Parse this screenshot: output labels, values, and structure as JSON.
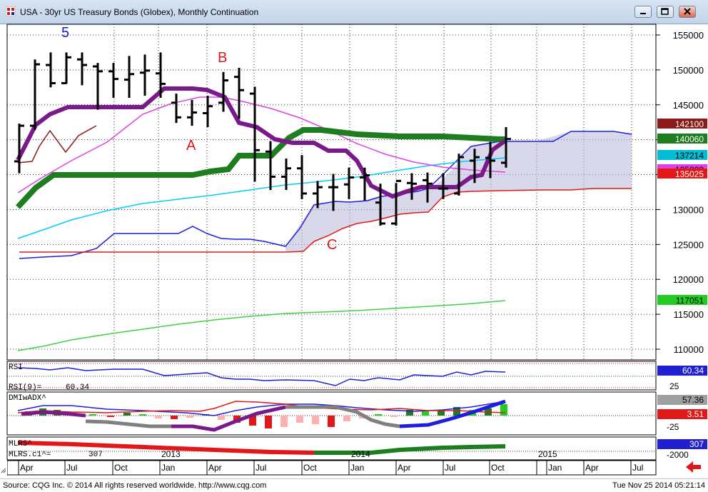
{
  "window": {
    "title": "USA - 30yr US Treasury Bonds (Globex), Monthly Continuation",
    "controls": [
      "minimize",
      "restore",
      "close"
    ]
  },
  "price_axis": {
    "ticks": [
      "155000",
      "150000",
      "145000",
      "140000",
      "135000",
      "130000",
      "125000",
      "120000",
      "115000",
      "110000"
    ]
  },
  "price_labels": [
    {
      "text": "142100",
      "bg": "#8b1a1a",
      "fg": "#ffffff"
    },
    {
      "text": "140060",
      "bg": "#1e7d1e",
      "fg": "#ffffff"
    },
    {
      "text": "137214",
      "bg": "#00bcd4",
      "fg": "#000000"
    },
    {
      "text": "135829",
      "bg": "#e040e0",
      "fg": "#000000"
    },
    {
      "text": "135025",
      "bg": "#e01818",
      "fg": "#ffffff"
    },
    {
      "text": "117051",
      "bg": "#22cc22",
      "fg": "#000000"
    }
  ],
  "annotations": [
    {
      "text": "5",
      "color": "#1a1ad0"
    },
    {
      "text": "B",
      "color": "#e01818"
    },
    {
      "text": "A",
      "color": "#e01818"
    },
    {
      "text": "C",
      "color": "#e01818"
    }
  ],
  "rsi": {
    "header": "RSI",
    "legend": "RSI(9)=",
    "value": "60.34",
    "axis_ticks": [
      "25"
    ]
  },
  "dmi": {
    "header": "DMIwADX^",
    "value_top": "57.36",
    "value_mid": "3.51",
    "axis_ticks": [
      "-25"
    ]
  },
  "mlrs": {
    "header": "MLRS^",
    "legend": "MLRS.c1^=",
    "legend_value": "307",
    "value": "307",
    "axis_ticks": [
      "-2000"
    ],
    "year_labels": [
      "2013",
      "2014"
    ]
  },
  "time_axis": {
    "labels": [
      "Apr",
      "Jul",
      "Oct",
      "Jan",
      "Apr",
      "Jul",
      "Oct",
      "Jan",
      "Apr",
      "Jul",
      "Oct",
      "2015",
      "Jan",
      "Apr",
      "Jul"
    ],
    "divider_years": [
      "2013",
      "2014",
      "2015"
    ]
  },
  "footer": {
    "source": "Source: CQG Inc. © 2014 All rights reserved worldwide. http://www.cqg.com",
    "timestamp": "Tue Nov 25 2014 05:21:14"
  },
  "chart_data": {
    "type": "ohlc",
    "title": "USA - 30yr US Treasury Bonds (Globex), Monthly Continuation",
    "ylim": [
      105000,
      157000
    ],
    "x": [
      "2012-04",
      "2012-05",
      "2012-06",
      "2012-07",
      "2012-08",
      "2012-09",
      "2012-10",
      "2012-11",
      "2012-12",
      "2013-01",
      "2013-02",
      "2013-03",
      "2013-04",
      "2013-05",
      "2013-06",
      "2013-07",
      "2013-08",
      "2013-09",
      "2013-10",
      "2013-11",
      "2013-12",
      "2014-01",
      "2014-02",
      "2014-03",
      "2014-04",
      "2014-05",
      "2014-06",
      "2014-07",
      "2014-08",
      "2014-09",
      "2014-10",
      "2014-11"
    ],
    "bars": [
      {
        "o": 136900,
        "h": 142300,
        "l": 135200,
        "c": 142000
      },
      {
        "o": 142000,
        "h": 151500,
        "l": 141400,
        "c": 150800
      },
      {
        "o": 150700,
        "h": 152500,
        "l": 147500,
        "c": 148100
      },
      {
        "o": 148100,
        "h": 152500,
        "l": 148000,
        "c": 151800
      },
      {
        "o": 151500,
        "h": 152500,
        "l": 147800,
        "c": 150700
      },
      {
        "o": 150500,
        "h": 151000,
        "l": 144300,
        "c": 149800
      },
      {
        "o": 149800,
        "h": 151000,
        "l": 146000,
        "c": 148700
      },
      {
        "o": 148600,
        "h": 152000,
        "l": 146000,
        "c": 149400
      },
      {
        "o": 149600,
        "h": 152200,
        "l": 146300,
        "c": 149900
      },
      {
        "o": 149500,
        "h": 152500,
        "l": 146000,
        "c": 148000
      },
      {
        "o": 145300,
        "h": 146600,
        "l": 142400,
        "c": 143200
      },
      {
        "o": 143200,
        "h": 145700,
        "l": 142000,
        "c": 143900
      },
      {
        "o": 143800,
        "h": 146300,
        "l": 141800,
        "c": 144800
      },
      {
        "o": 145300,
        "h": 149700,
        "l": 144000,
        "c": 148500
      },
      {
        "o": 149000,
        "h": 150300,
        "l": 143000,
        "c": 147100
      },
      {
        "o": 146600,
        "h": 147600,
        "l": 134000,
        "c": 138500
      },
      {
        "o": 138300,
        "h": 139800,
        "l": 132800,
        "c": 134700
      },
      {
        "o": 134700,
        "h": 137300,
        "l": 132800,
        "c": 135900
      },
      {
        "o": 135900,
        "h": 137800,
        "l": 131500,
        "c": 132300
      },
      {
        "o": 132300,
        "h": 134100,
        "l": 130200,
        "c": 133200
      },
      {
        "o": 133200,
        "h": 135100,
        "l": 129800,
        "c": 133200
      },
      {
        "o": 133600,
        "h": 136000,
        "l": 131500,
        "c": 134600
      },
      {
        "o": 134600,
        "h": 136000,
        "l": 131300,
        "c": 134900
      },
      {
        "o": 131000,
        "h": 133700,
        "l": 127700,
        "c": 128000
      },
      {
        "o": 128000,
        "h": 133800,
        "l": 127700,
        "c": 134100
      },
      {
        "o": 133800,
        "h": 135200,
        "l": 131400,
        "c": 133700
      },
      {
        "o": 134200,
        "h": 135300,
        "l": 131000,
        "c": 133700
      },
      {
        "o": 133000,
        "h": 135200,
        "l": 131500,
        "c": 133000
      },
      {
        "o": 132300,
        "h": 138000,
        "l": 132000,
        "c": 137500
      },
      {
        "o": 137000,
        "h": 138700,
        "l": 133800,
        "c": 137500
      },
      {
        "o": 137400,
        "h": 139700,
        "l": 134500,
        "c": 137000
      },
      {
        "o": 136700,
        "h": 141800,
        "l": 136000,
        "c": 140100
      }
    ]
  }
}
